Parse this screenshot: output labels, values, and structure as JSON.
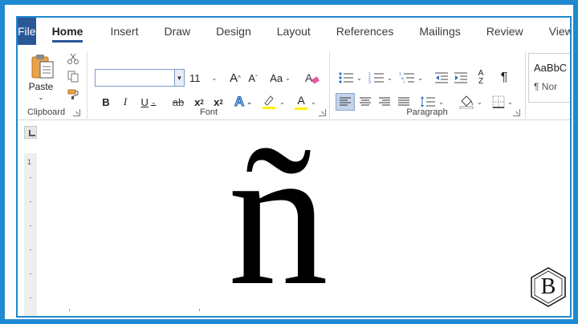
{
  "tabs": [
    "File",
    "Home",
    "Insert",
    "Draw",
    "Design",
    "Layout",
    "References",
    "Mailings",
    "Review",
    "View"
  ],
  "active_tab": "Home",
  "clipboard": {
    "paste_label": "Paste",
    "group_label": "Clipboard"
  },
  "font": {
    "name_value": "",
    "size_value": "11",
    "grow_label": "A",
    "shrink_label": "A",
    "case_label": "Aa",
    "bold_label": "B",
    "italic_label": "I",
    "underline_label": "U",
    "strike_label": "ab",
    "subscript_label": "x",
    "superscript_label": "x",
    "sub_mark": "2",
    "sup_mark": "2",
    "effects_label": "A",
    "color_label": "A",
    "group_label": "Font",
    "highlight_color": "#ffef00",
    "font_color": "#ffef00"
  },
  "paragraph": {
    "group_label": "Paragraph",
    "pilcrow": "¶",
    "sort_label_top": "A",
    "sort_label_bottom": "Z"
  },
  "styles": {
    "normal_preview": "AaBbC",
    "normal_label": "¶ Nor"
  },
  "document": {
    "character": "ñ",
    "ruler_number": "1"
  },
  "logo": {
    "letter": "B"
  },
  "colors": {
    "frame": "#1e88d0",
    "file_tab": "#2b5797",
    "accent": "#2b5797",
    "align_selected": "#c5d3e8"
  }
}
